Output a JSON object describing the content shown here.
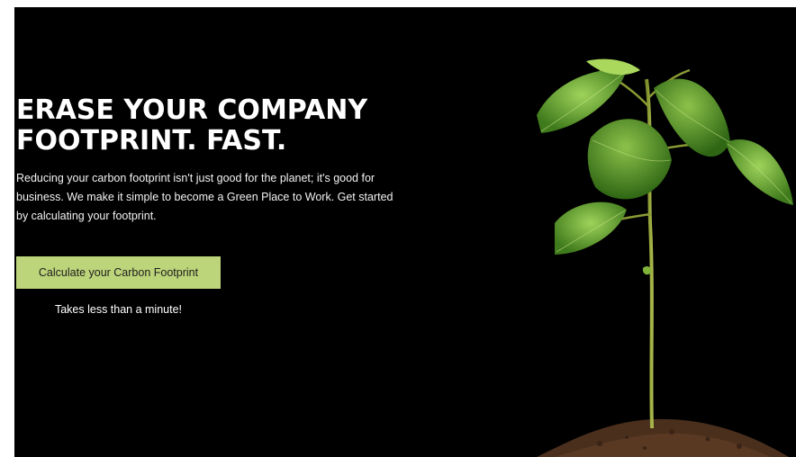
{
  "hero": {
    "title_line1": "ERASE YOUR COMPANY",
    "title_line2": "FOOTPRINT. FAST.",
    "description": "Reducing your carbon footprint isn't just good for the planet; it's good for business. We make it simple to become a Green Place to Work. Get started by calculating your footprint."
  },
  "cta": {
    "button_label": "Calculate your Carbon Footprint",
    "note": "Takes less than a minute!"
  },
  "colors": {
    "background": "#000000",
    "button": "#bcd47a",
    "leaf": "#6aa832",
    "soil": "#4a2f1d"
  },
  "image": {
    "subject": "seedling-plant-icon"
  }
}
